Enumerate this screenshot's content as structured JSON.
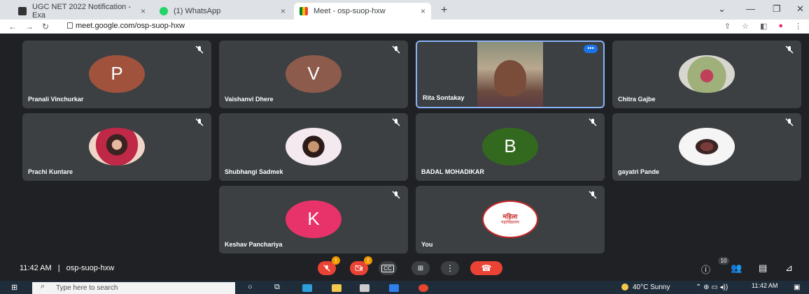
{
  "browser": {
    "tabs": [
      {
        "label": "UGC NET 2022 Notification - Exa",
        "close": "×"
      },
      {
        "label": "(1) WhatsApp",
        "close": "×"
      },
      {
        "label": "Meet - osp-suop-hxw",
        "close": "×"
      }
    ],
    "new_tab": "+",
    "url": "meet.google.com/osp-suop-hxw",
    "window_controls": [
      "⌄",
      "—",
      "❐",
      "✕"
    ]
  },
  "participants": [
    {
      "name": "Pranali Vinchurkar",
      "initial": "P",
      "avatar_color": "#a0523d",
      "muted": true
    },
    {
      "name": "Vaishanvi Dhere",
      "initial": "V",
      "avatar_color": "#8d5b4c",
      "muted": true
    },
    {
      "name": "Rita Sontakay",
      "video": true,
      "speaking": true
    },
    {
      "name": "Chitra Gajbe",
      "photo": true,
      "muted": true
    },
    {
      "name": "Prachi Kuntare",
      "photo": true,
      "muted": true
    },
    {
      "name": "Shubhangi Sadmek",
      "photo": true,
      "muted": true
    },
    {
      "name": "BADAL MOHADIKAR",
      "initial": "B",
      "avatar_color": "#33691e",
      "muted": true
    },
    {
      "name": "gayatri Pande",
      "photo": true,
      "muted": true
    },
    {
      "name": "Keshav Panchariya",
      "initial": "K",
      "avatar_color": "#e8336a",
      "muted": true
    },
    {
      "name": "You",
      "logo_lines": [
        "महिला",
        "महाविद्यालय"
      ],
      "muted": true
    }
  ],
  "meeting": {
    "time": "11:42 AM",
    "separator": "|",
    "code": "osp-suop-hxw",
    "participant_count": "10",
    "warning_mark": "!"
  },
  "taskbar": {
    "search_placeholder": "Type here to search",
    "weather": "40°C  Sunny",
    "time": "11:42 AM"
  },
  "colors": {
    "accent_blue": "#8ab4f8",
    "end_call_red": "#ea4335",
    "tile_bg": "#3c4043"
  }
}
